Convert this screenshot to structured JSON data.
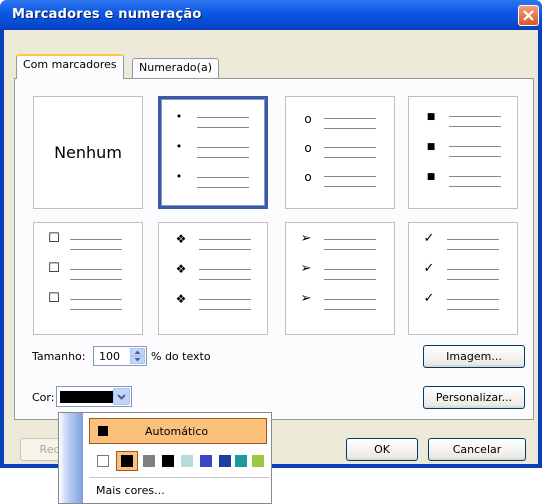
{
  "window": {
    "title": "Marcadores e numeração"
  },
  "tabs": [
    {
      "label": "Com marcadores",
      "active": true
    },
    {
      "label": "Numerado(a)",
      "active": false
    }
  ],
  "bullet_styles": {
    "none_label": "Nenhum",
    "bullets": [
      "•",
      "o",
      "■",
      "☐",
      "❖",
      "➢",
      "✓"
    ],
    "selected_index": 1
  },
  "size": {
    "label": "Tamanho:",
    "value": "100",
    "suffix": "% do texto"
  },
  "color": {
    "label": "Cor:",
    "selected": "#000000"
  },
  "buttons": {
    "image": "Imagem...",
    "customize": "Personalizar...",
    "reset": "Red",
    "ok": "OK",
    "cancel": "Cancelar"
  },
  "color_menu": {
    "automatic": "Automático",
    "more_colors": "Mais cores...",
    "swatches": [
      "#ffffff",
      "#000000",
      "#808080",
      "#000000",
      "#1f3f9f",
      "#3a46c6",
      "#1f9a9a",
      "#9bc83c"
    ],
    "automatic_color": "#000000",
    "highlight": "#fbc07a",
    "light_swatch": "#b8dcdc"
  },
  "colors": {
    "title_bar": "#0b56e3",
    "selection_border": "#3c5aa8",
    "dialog_bg": "#ece9d8"
  }
}
